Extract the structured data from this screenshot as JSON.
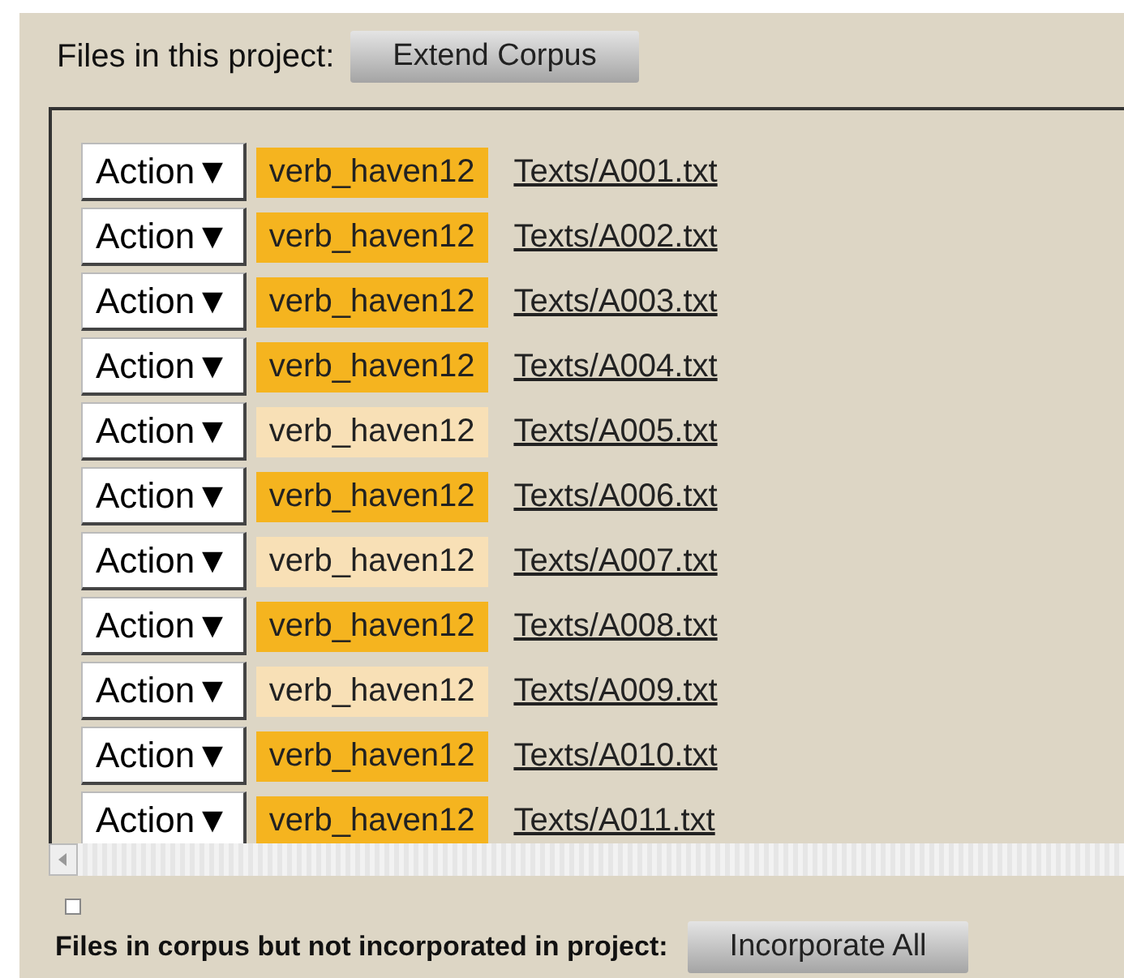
{
  "header": {
    "label": "Files in this project:",
    "button": "Extend Corpus"
  },
  "files": [
    {
      "action": "Action▼",
      "tag": "verb_haven12",
      "color": "#f5b41f",
      "path": "Texts/A001.txt"
    },
    {
      "action": "Action▼",
      "tag": "verb_haven12",
      "color": "#f5b41f",
      "path": "Texts/A002.txt"
    },
    {
      "action": "Action▼",
      "tag": "verb_haven12",
      "color": "#f5b41f",
      "path": "Texts/A003.txt"
    },
    {
      "action": "Action▼",
      "tag": "verb_haven12",
      "color": "#f5b41f",
      "path": "Texts/A004.txt"
    },
    {
      "action": "Action▼",
      "tag": "verb_haven12",
      "color": "#f8e0b6",
      "path": "Texts/A005.txt"
    },
    {
      "action": "Action▼",
      "tag": "verb_haven12",
      "color": "#f5b41f",
      "path": "Texts/A006.txt"
    },
    {
      "action": "Action▼",
      "tag": "verb_haven12",
      "color": "#f8e0b6",
      "path": "Texts/A007.txt"
    },
    {
      "action": "Action▼",
      "tag": "verb_haven12",
      "color": "#f5b41f",
      "path": "Texts/A008.txt"
    },
    {
      "action": "Action▼",
      "tag": "verb_haven12",
      "color": "#f8e0b6",
      "path": "Texts/A009.txt"
    },
    {
      "action": "Action▼",
      "tag": "verb_haven12",
      "color": "#f5b41f",
      "path": "Texts/A010.txt"
    },
    {
      "action": "Action▼",
      "tag": "verb_haven12",
      "color": "#f5b41f",
      "path": "Texts/A011.txt"
    }
  ],
  "checkbox": {
    "checked": false
  },
  "footer": {
    "label": "Files in corpus but not incorporated in project:",
    "button": "Incorporate All"
  }
}
